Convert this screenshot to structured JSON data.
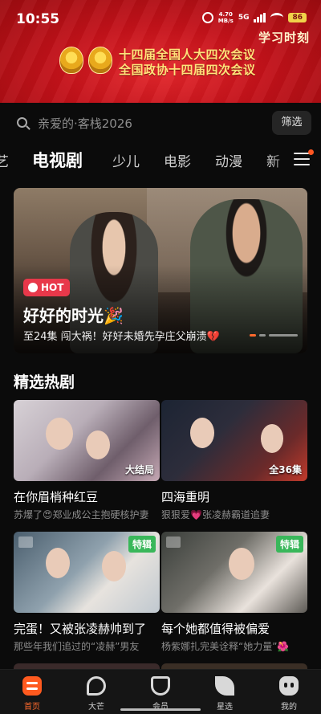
{
  "status_bar": {
    "time": "10:55",
    "speed": "4.70",
    "speed_unit": "MB/s",
    "network": "5G",
    "battery": "86"
  },
  "banner": {
    "brand": "学习时刻",
    "line1": "十四届全国人大四次会议",
    "line2": "全国政协十四届四次会议",
    "colors": {
      "background": "#c4121a",
      "text": "#ffe27a"
    }
  },
  "search": {
    "placeholder": "亲爱的·客栈2026",
    "filter_label": "筛选"
  },
  "tabs": [
    {
      "label": "艺"
    },
    {
      "label": "电视剧",
      "active": true
    },
    {
      "label": "少儿"
    },
    {
      "label": "电影"
    },
    {
      "label": "动漫"
    },
    {
      "label": "新"
    }
  ],
  "hero": {
    "badge": "HOT",
    "title": "好好的时光🎉",
    "subtitle": "至24集 闯大祸！好好未婚先孕庄父崩溃💔"
  },
  "section": {
    "title": "精选热剧"
  },
  "cards": [
    {
      "title": "在你眉梢种红豆",
      "subtitle": "苏爆了😍郑业成公主抱硬核护妻",
      "badge": "大结局"
    },
    {
      "title": "四海重明",
      "subtitle": "狠狠爱💗张凌赫霸道追妻",
      "badge": "全36集"
    },
    {
      "title": "完蛋！又被张凌赫帅到了",
      "subtitle": "那些年我们追过的“凌赫”男友",
      "badge": "特辑"
    },
    {
      "title": "每个她都值得被偏爱",
      "subtitle": "杨紫娜扎完美诠释“她力量”🌺",
      "badge": "特辑"
    }
  ],
  "bottom_nav": [
    {
      "label": "首页",
      "icon": "home-logo-icon",
      "active": true
    },
    {
      "label": "大芒",
      "icon": "dama-icon"
    },
    {
      "label": "会员",
      "icon": "vip-heart-icon"
    },
    {
      "label": "星选",
      "icon": "leaf-icon"
    },
    {
      "label": "我的",
      "icon": "profile-face-icon"
    }
  ],
  "accent_color": "#ff6a2d"
}
